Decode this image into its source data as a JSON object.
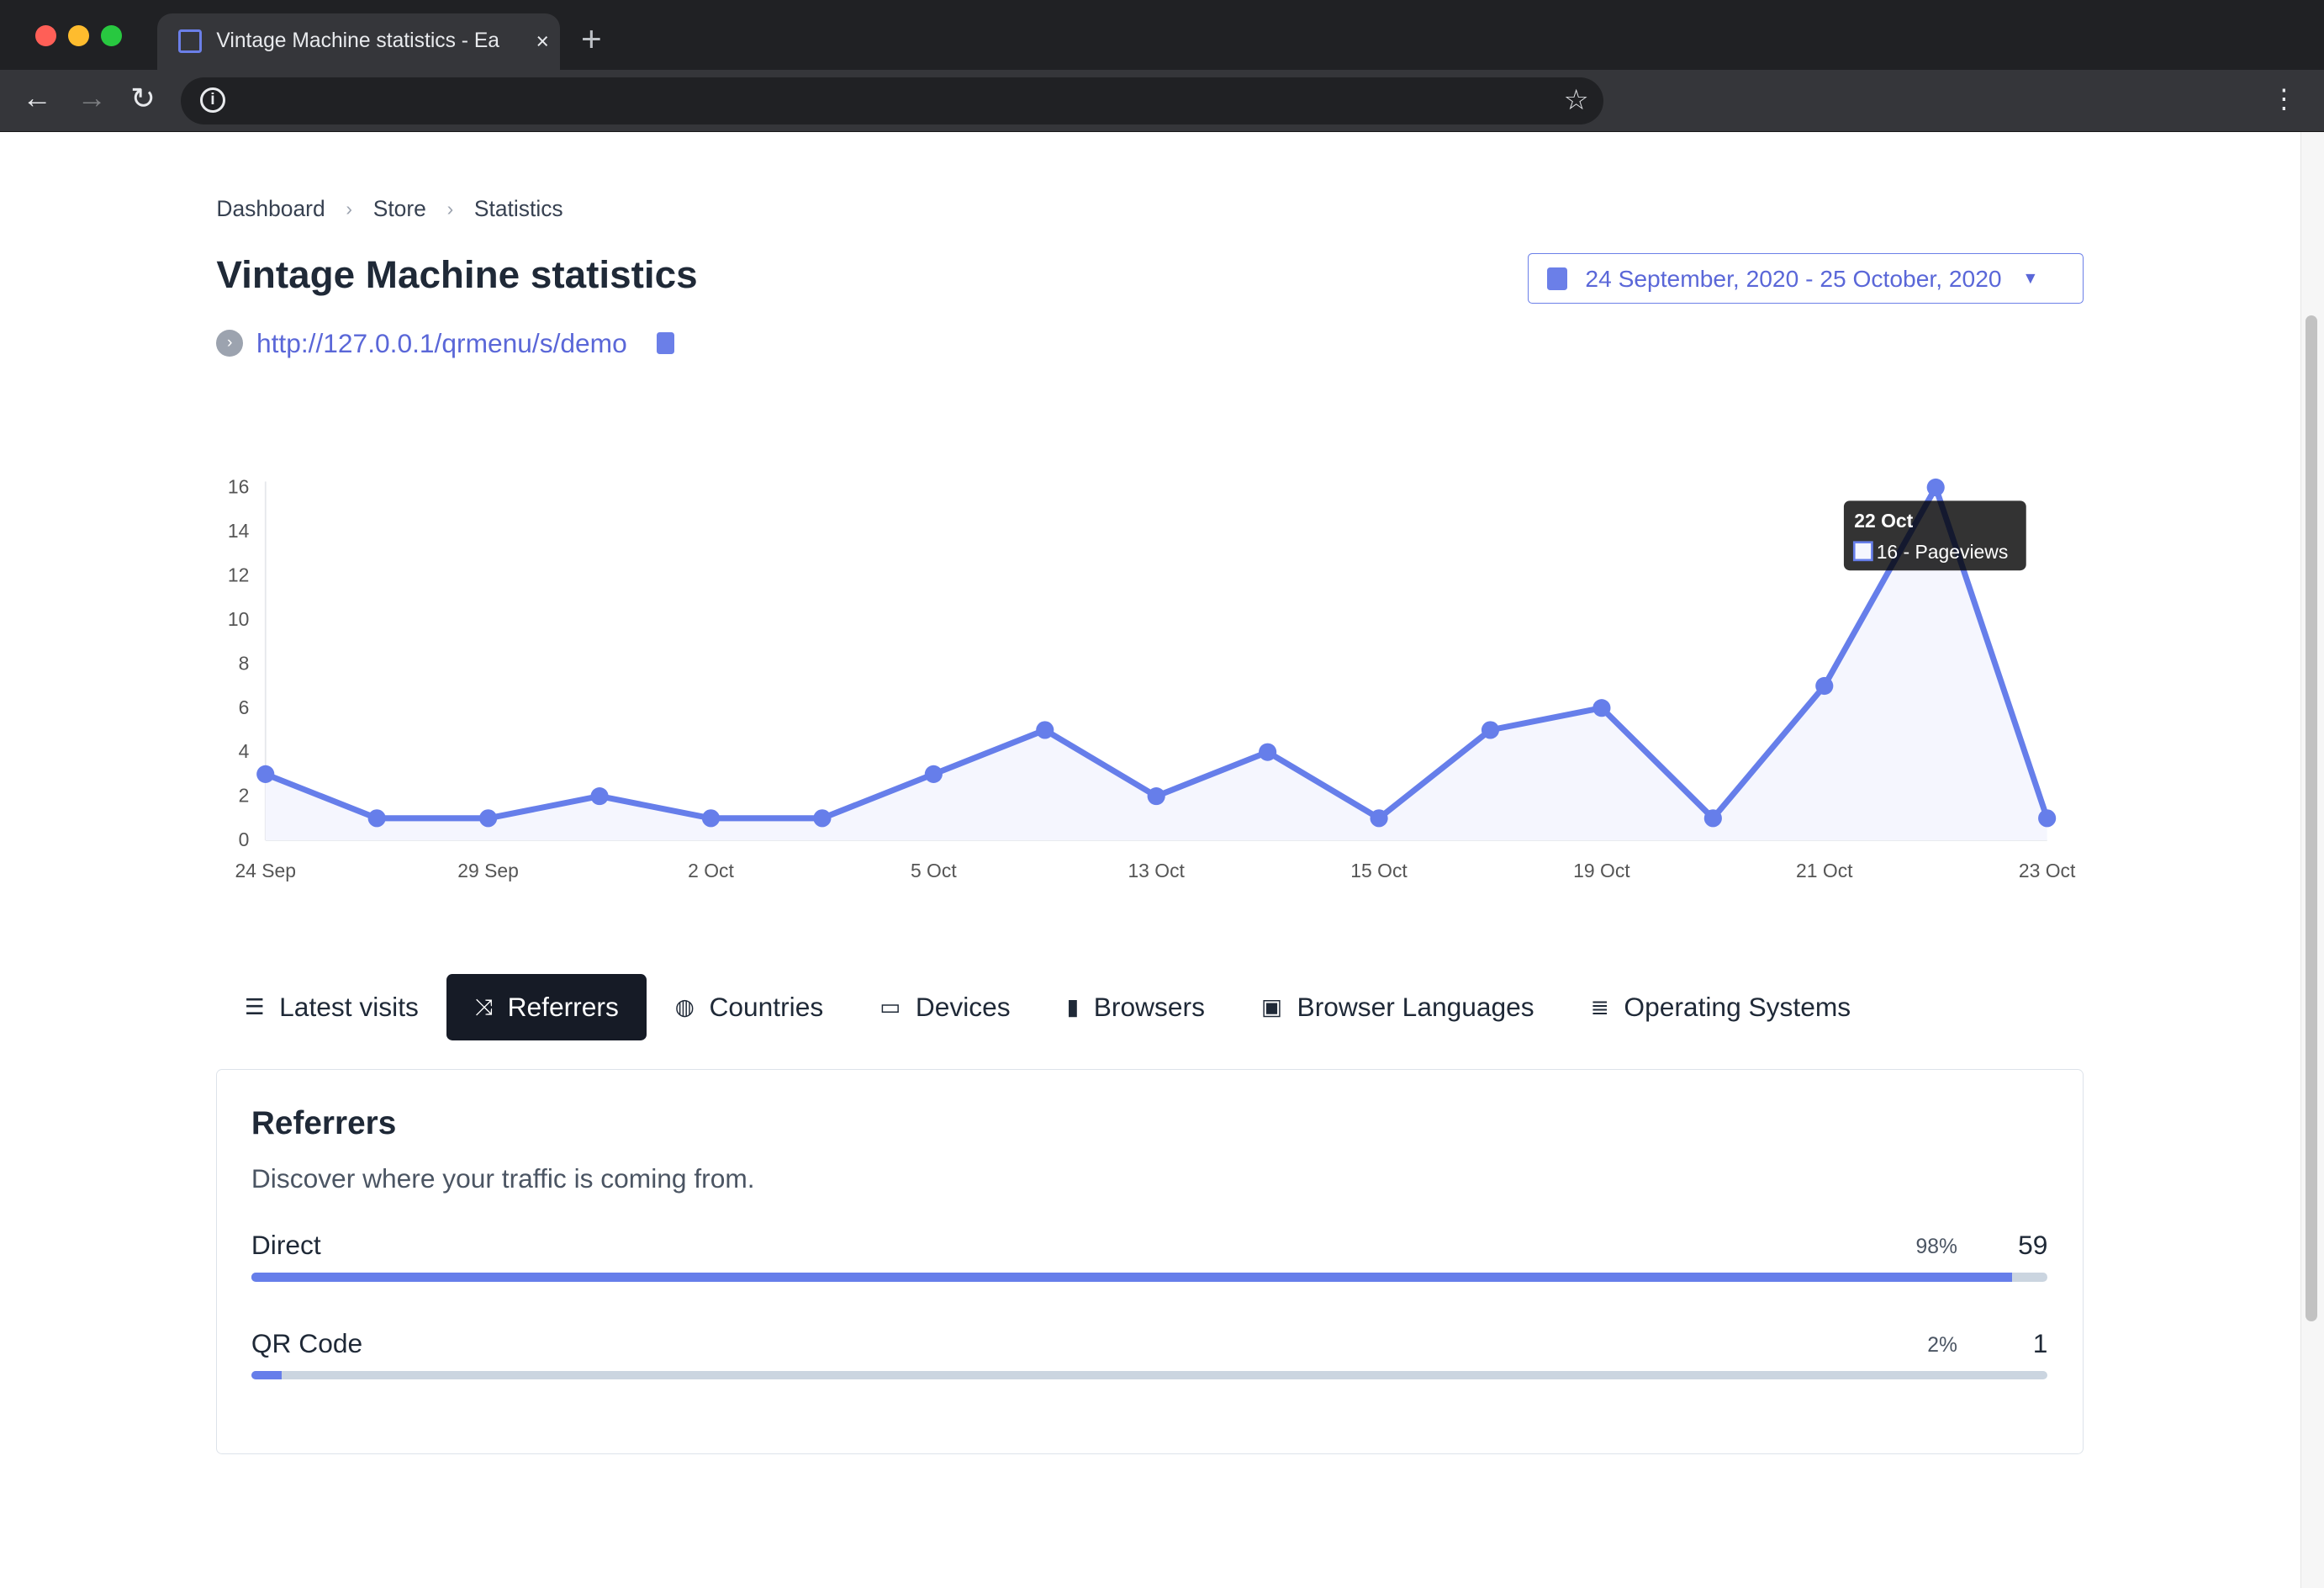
{
  "browser": {
    "tab_title": "Vintage Machine statistics - Ea",
    "close_icon": "×",
    "new_tab_icon": "+"
  },
  "breadcrumb": [
    "Dashboard",
    "Store",
    "Statistics"
  ],
  "page": {
    "title": "Vintage Machine statistics",
    "url": "http://127.0.0.1/qrmenu/s/demo",
    "date_range": "24 September, 2020 - 25 October, 2020"
  },
  "colors": {
    "accent": "#667eea",
    "dark": "#161b26",
    "track": "#cbd5e0"
  },
  "chart_data": {
    "type": "area",
    "categories": [
      "24 Sep",
      "",
      "29 Sep",
      "",
      "2 Oct",
      "",
      "5 Oct",
      "",
      "13 Oct",
      "",
      "15 Oct",
      "",
      "19 Oct",
      "",
      "21 Oct",
      "",
      "23 Oct"
    ],
    "series": [
      {
        "name": "Pageviews",
        "values": [
          3,
          1,
          1,
          2,
          1,
          1,
          3,
          5,
          2,
          4,
          1,
          5,
          6,
          1,
          7,
          16,
          1
        ]
      }
    ],
    "ylim": [
      0,
      16
    ],
    "yticks": [
      0,
      2,
      4,
      6,
      8,
      10,
      12,
      14,
      16
    ],
    "grid": false,
    "tooltip": {
      "title": "22 Oct",
      "text": "16 - Pageviews",
      "index": 15
    }
  },
  "tabs": [
    {
      "label": "Latest visits",
      "icon": "list-icon"
    },
    {
      "label": "Referrers",
      "icon": "shuffle-icon",
      "active": true
    },
    {
      "label": "Countries",
      "icon": "globe-icon"
    },
    {
      "label": "Devices",
      "icon": "laptop-icon"
    },
    {
      "label": "Browsers",
      "icon": "window-icon"
    },
    {
      "label": "Browser Languages",
      "icon": "language-icon"
    },
    {
      "label": "Operating Systems",
      "icon": "server-icon"
    }
  ],
  "referrers": {
    "title": "Referrers",
    "description": "Discover where your traffic is coming from.",
    "rows": [
      {
        "label": "Direct",
        "percent": "98%",
        "count": "59",
        "fraction": 0.98
      },
      {
        "label": "QR Code",
        "percent": "2%",
        "count": "1",
        "fraction": 0.017
      }
    ]
  }
}
